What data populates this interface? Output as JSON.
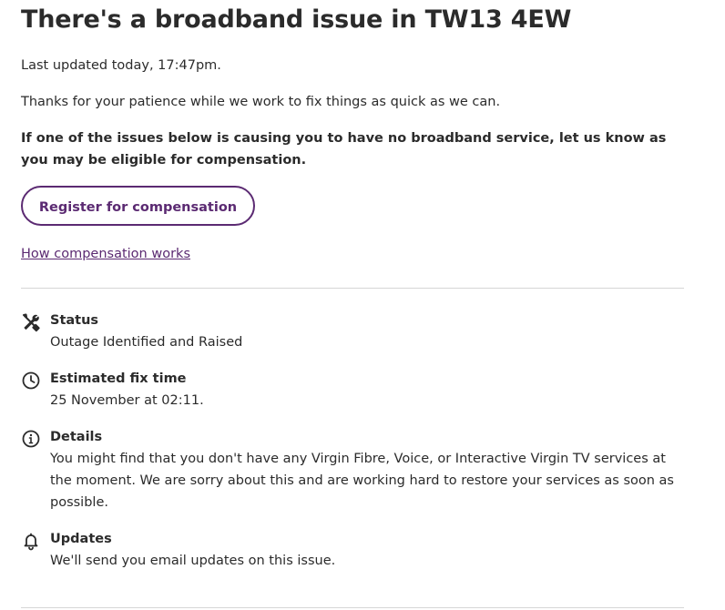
{
  "page": {
    "title": "There's a broadband issue in TW13 4EW",
    "last_updated": "Last updated today, 17:47pm.",
    "thanks": "Thanks for your patience while we work to fix things as quick as we can.",
    "compensation_notice": "If one of the issues below is causing you to have no broadband service, let us know as you may be eligible for compensation.",
    "register_button": "Register for compensation",
    "how_link": "How compensation works"
  },
  "colors": {
    "accent": "#5b2a72",
    "text": "#2b2b2b",
    "divider": "#d6d6d6"
  },
  "issue": {
    "status": {
      "icon": "tools-icon",
      "label": "Status",
      "value": "Outage Identified and Raised"
    },
    "fix_time": {
      "icon": "clock-icon",
      "label": "Estimated fix time",
      "value": "25 November at 02:11."
    },
    "details": {
      "icon": "info-icon",
      "label": "Details",
      "value": "You might find that you don't have any Virgin Fibre, Voice, or Interactive Virgin TV services at the moment. We are sorry about this and are working hard to restore your services as soon as possible."
    },
    "updates": {
      "icon": "bell-icon",
      "label": "Updates",
      "value": "We'll send you email updates on this issue."
    }
  }
}
